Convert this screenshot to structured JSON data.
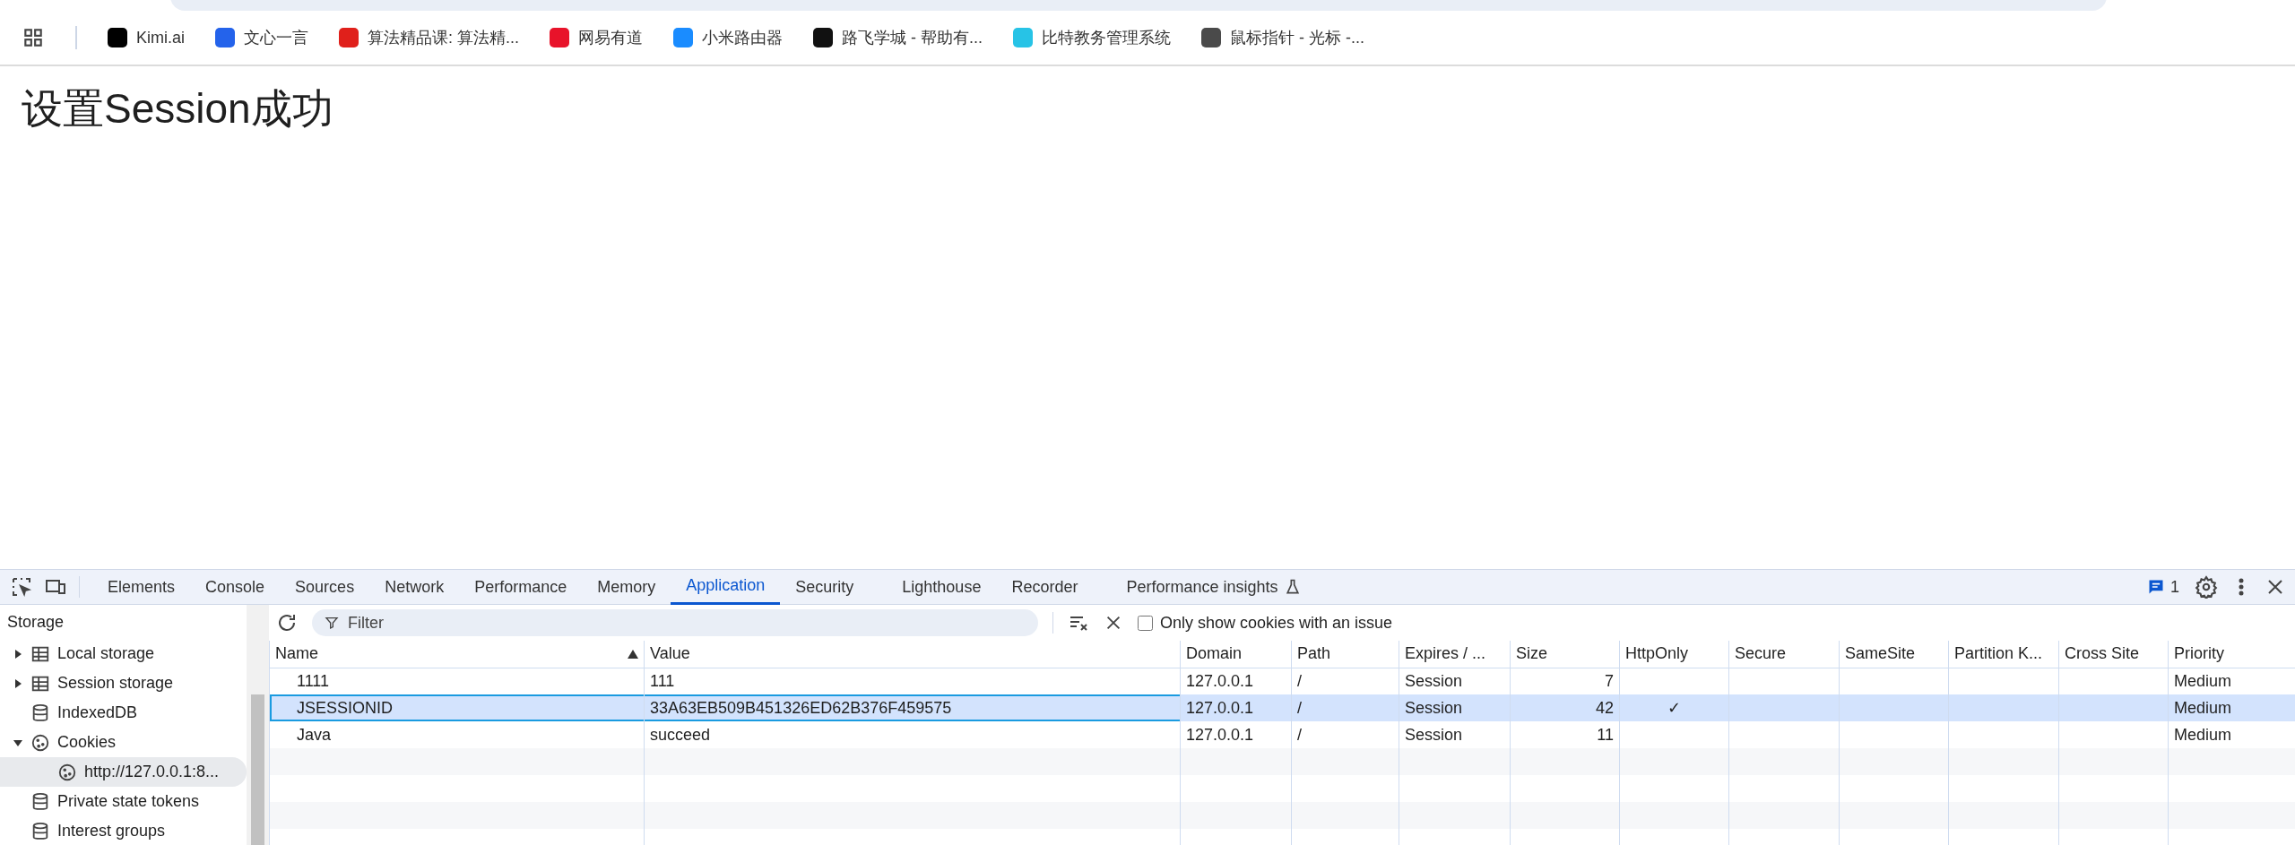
{
  "bookmarks": [
    {
      "label": "Kimi.ai",
      "color": "#000000"
    },
    {
      "label": "文心一言",
      "color": "#2463eb"
    },
    {
      "label": "算法精品课: 算法精...",
      "color": "#e0201b"
    },
    {
      "label": "网易有道",
      "color": "#e8132a"
    },
    {
      "label": "小米路由器",
      "color": "#1a8cff"
    },
    {
      "label": "路飞学城 - 帮助有...",
      "color": "#111111"
    },
    {
      "label": "比特教务管理系统",
      "color": "#27c3e6"
    },
    {
      "label": "鼠标指针 - 光标 -...",
      "color": "#4a4a4a"
    }
  ],
  "page": {
    "heading": "设置Session成功"
  },
  "devtools": {
    "tabs": [
      {
        "label": "Elements",
        "selected": false
      },
      {
        "label": "Console",
        "selected": false
      },
      {
        "label": "Sources",
        "selected": false
      },
      {
        "label": "Network",
        "selected": false
      },
      {
        "label": "Performance",
        "selected": false
      },
      {
        "label": "Memory",
        "selected": false
      },
      {
        "label": "Application",
        "selected": true
      },
      {
        "label": "Security",
        "selected": false
      },
      {
        "label": "Lighthouse",
        "selected": false
      },
      {
        "label": "Recorder",
        "selected": false
      },
      {
        "label": "Performance insights",
        "selected": false
      }
    ],
    "issues_count": "1",
    "filter": {
      "placeholder": "Filter"
    },
    "only_issues": {
      "label": "Only show cookies with an issue",
      "checked": false
    },
    "sidebar": {
      "title": "Storage",
      "items": [
        {
          "label": "Local storage",
          "kind": "table",
          "expanded": false,
          "selected": false
        },
        {
          "label": "Session storage",
          "kind": "table",
          "expanded": false,
          "selected": false
        },
        {
          "label": "IndexedDB",
          "kind": "database",
          "selected": false
        },
        {
          "label": "Cookies",
          "kind": "cookie",
          "expanded": true,
          "selected": false,
          "children": [
            {
              "label": "http://127.0.0.1:8...",
              "kind": "cookie",
              "selected": true
            }
          ]
        },
        {
          "label": "Private state tokens",
          "kind": "database",
          "selected": false
        },
        {
          "label": "Interest groups",
          "kind": "database",
          "selected": false
        }
      ]
    },
    "table": {
      "columns": [
        {
          "label": "Name",
          "kind": "text",
          "sorted": true
        },
        {
          "label": "Value",
          "kind": "text",
          "sorted": false
        },
        {
          "label": "Domain",
          "kind": "text",
          "sorted": false
        },
        {
          "label": "Path",
          "kind": "text",
          "sorted": false
        },
        {
          "label": "Expires / ...",
          "kind": "text",
          "sorted": false
        },
        {
          "label": "Size",
          "kind": "number",
          "sorted": false
        },
        {
          "label": "HttpOnly",
          "kind": "flag",
          "sorted": false
        },
        {
          "label": "Secure",
          "kind": "flag",
          "sorted": false
        },
        {
          "label": "SameSite",
          "kind": "text",
          "sorted": false
        },
        {
          "label": "Partition K...",
          "kind": "text",
          "sorted": false
        },
        {
          "label": "Cross Site",
          "kind": "flag",
          "sorted": false
        },
        {
          "label": "Priority",
          "kind": "text",
          "sorted": false
        }
      ],
      "rows": [
        {
          "selected": false,
          "cells": [
            "1111",
            "111",
            "127.0.0.1",
            "/",
            "Session",
            "7",
            "",
            "",
            "",
            "",
            "",
            "Medium"
          ]
        },
        {
          "selected": true,
          "cells": [
            "JSESSIONID",
            "33A63EB509B451326ED62B376F459575",
            "127.0.0.1",
            "/",
            "Session",
            "42",
            "✓",
            "",
            "",
            "",
            "",
            "Medium"
          ]
        },
        {
          "selected": false,
          "cells": [
            "Java",
            "succeed",
            "127.0.0.1",
            "/",
            "Session",
            "11",
            "",
            "",
            "",
            "",
            "",
            "Medium"
          ]
        }
      ]
    }
  }
}
